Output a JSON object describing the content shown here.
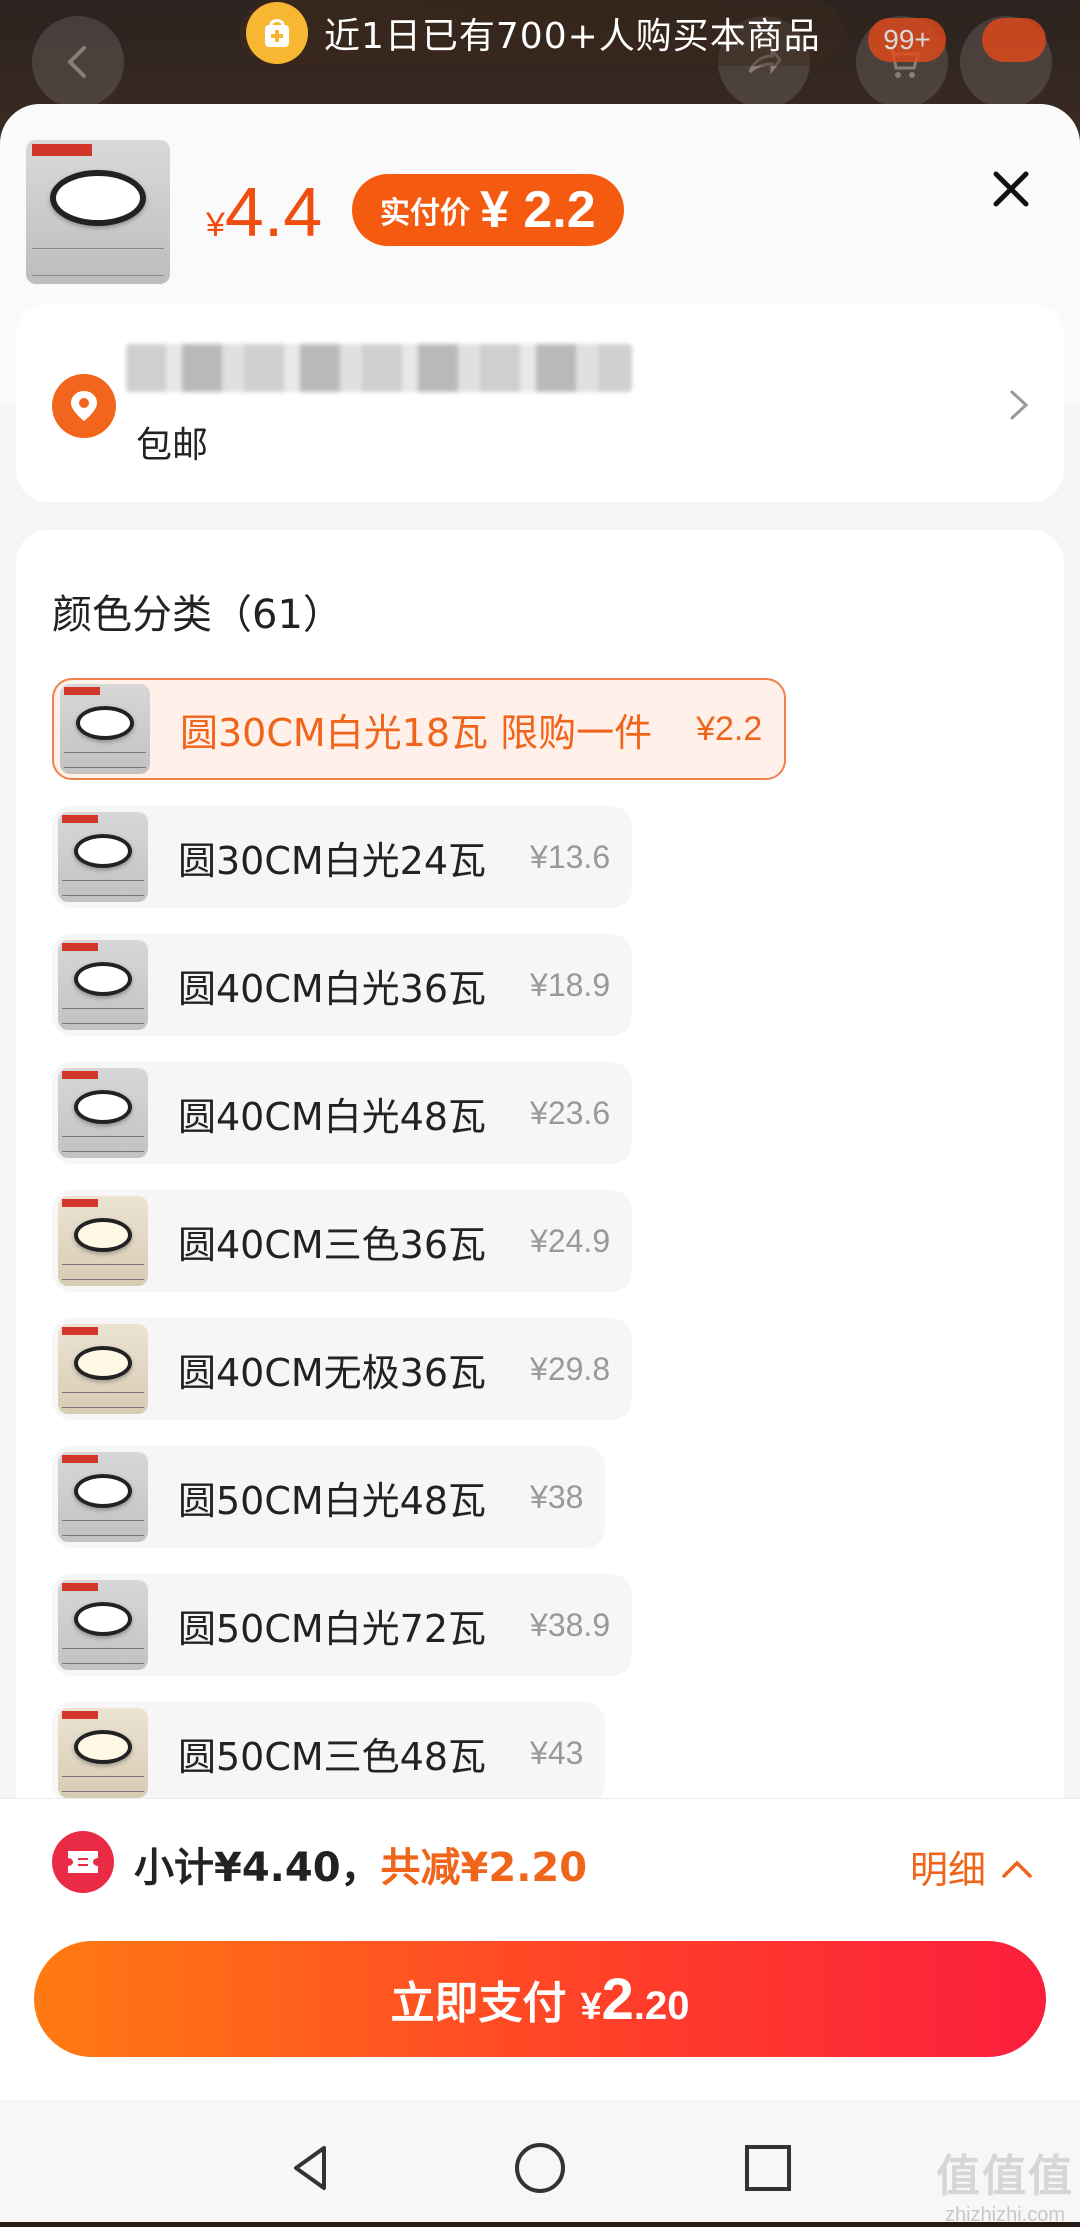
{
  "banner": {
    "text": "近1日已有700+人购买本商品"
  },
  "header": {
    "cart_badge": "99+"
  },
  "product": {
    "currency": "¥",
    "price": "4.4",
    "real_price_label": "实付价",
    "real_price_currency": "¥",
    "real_price": "2.2"
  },
  "address": {
    "shipping": "包邮"
  },
  "specs": {
    "title": "颜色分类（61）",
    "items": [
      {
        "name": "圆30CM白光18瓦 限购一件",
        "price": "¥2.2",
        "selected": true,
        "tone": "cool"
      },
      {
        "name": "圆30CM白光24瓦",
        "price": "¥13.6",
        "selected": false,
        "tone": "cool"
      },
      {
        "name": "圆40CM白光36瓦",
        "price": "¥18.9",
        "selected": false,
        "tone": "cool"
      },
      {
        "name": "圆40CM白光48瓦",
        "price": "¥23.6",
        "selected": false,
        "tone": "cool"
      },
      {
        "name": "圆40CM三色36瓦",
        "price": "¥24.9",
        "selected": false,
        "tone": "warm"
      },
      {
        "name": "圆40CM无极36瓦",
        "price": "¥29.8",
        "selected": false,
        "tone": "warm"
      },
      {
        "name": "圆50CM白光48瓦",
        "price": "¥38",
        "selected": false,
        "tone": "cool"
      },
      {
        "name": "圆50CM白光72瓦",
        "price": "¥38.9",
        "selected": false,
        "tone": "cool"
      },
      {
        "name": "圆50CM三色48瓦",
        "price": "¥43",
        "selected": false,
        "tone": "warm"
      }
    ]
  },
  "summary": {
    "subtotal": "小计¥4.40，",
    "discount": "共减¥2.20",
    "detail_label": "明细"
  },
  "pay_button": {
    "label": "立即支付",
    "currency": "¥",
    "amount_int": "2",
    "amount_dec": ".20"
  },
  "watermark": {
    "logo": "值值值",
    "url": "zhizhizhi.com"
  },
  "icons": {
    "back": "chevron-left-icon",
    "share": "share-icon",
    "cart": "cart-icon",
    "more": "more-icon",
    "close": "close-icon",
    "location": "location-pin-icon",
    "chevron": "chevron-right-icon",
    "coupon": "coupon-icon",
    "expand": "chevron-up-icon"
  },
  "colors": {
    "accent": "#f0651c",
    "pay_gradient_start": "#ff7a12",
    "pay_gradient_end": "#fb1e3d"
  }
}
